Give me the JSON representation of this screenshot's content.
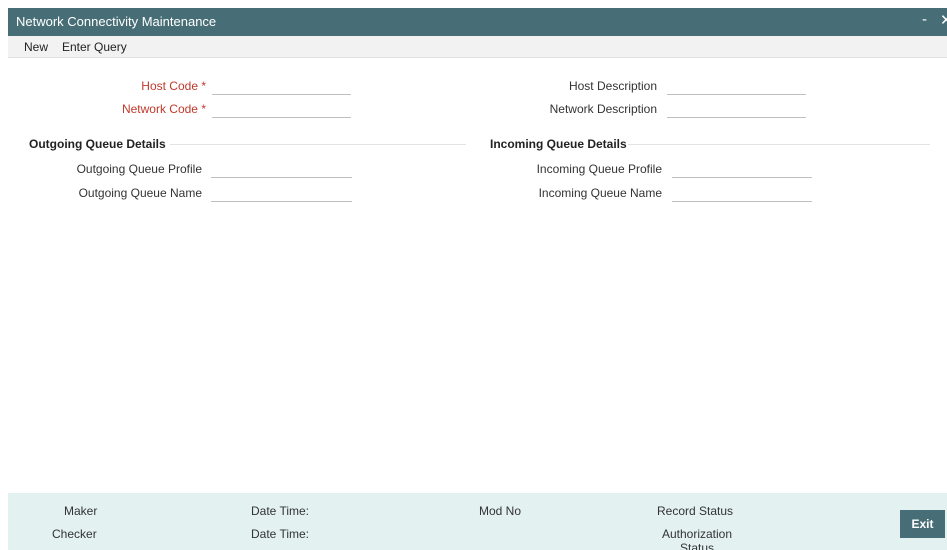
{
  "window": {
    "title": "Network Connectivity Maintenance",
    "minimize": "-",
    "close": "✕"
  },
  "menu": {
    "new": "New",
    "enter_query": "Enter Query"
  },
  "form": {
    "host_code": {
      "label": "Host Code *",
      "value": "",
      "required": true
    },
    "network_code": {
      "label": "Network Code *",
      "value": "",
      "required": true
    },
    "host_description": {
      "label": "Host Description",
      "value": ""
    },
    "network_description": {
      "label": "Network Description",
      "value": ""
    }
  },
  "outgoing": {
    "heading": "Outgoing Queue Details",
    "profile": {
      "label": "Outgoing Queue Profile",
      "value": ""
    },
    "name": {
      "label": "Outgoing Queue Name",
      "value": ""
    }
  },
  "incoming": {
    "heading": "Incoming Queue Details",
    "profile": {
      "label": "Incoming Queue Profile",
      "value": ""
    },
    "name": {
      "label": "Incoming Queue Name",
      "value": ""
    }
  },
  "footer": {
    "maker": "Maker",
    "checker": "Checker",
    "date_time_1": "Date Time:",
    "date_time_2": "Date Time:",
    "mod_no": "Mod No",
    "record_status": "Record Status",
    "authorization_status_line1": "Authorization",
    "authorization_status_line2": "Status",
    "exit": "Exit"
  },
  "colors": {
    "titlebar": "#476e76",
    "required_label": "#c0392b",
    "footer_bg": "#e3f1f1"
  }
}
